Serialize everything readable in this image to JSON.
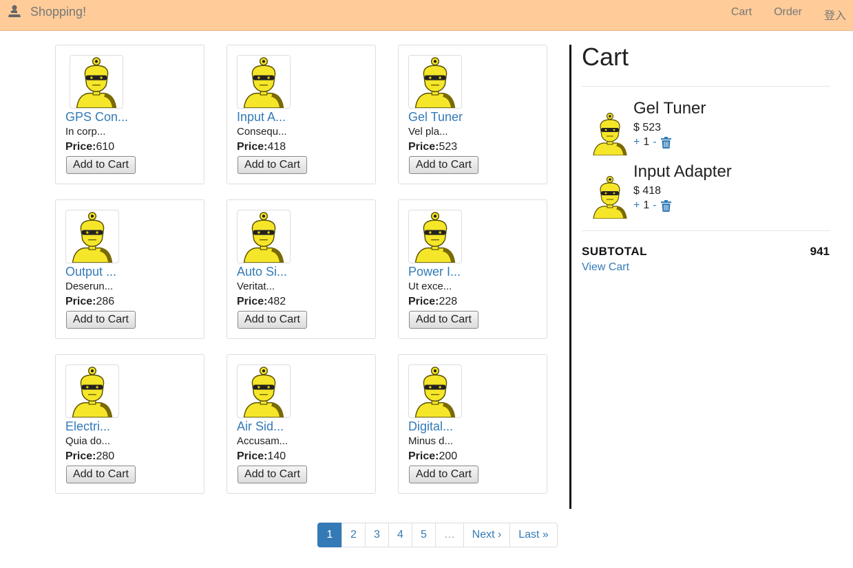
{
  "navbar": {
    "brand": "Shopping!",
    "brand_icon": "shopping-logo-icon",
    "links": [
      "Cart",
      "Order",
      "登入"
    ]
  },
  "products": [
    {
      "name": "GPS Con...",
      "desc": "In corp...",
      "price_label": "Price:",
      "price": "610",
      "button": "Add to Cart"
    },
    {
      "name": "Input A...",
      "desc": "Consequ...",
      "price_label": "Price:",
      "price": "418",
      "button": "Add to Cart"
    },
    {
      "name": "Gel Tuner",
      "desc": "Vel pla...",
      "price_label": "Price:",
      "price": "523",
      "button": "Add to Cart"
    },
    {
      "name": "Output ...",
      "desc": "Deserun...",
      "price_label": "Price:",
      "price": "286",
      "button": "Add to Cart"
    },
    {
      "name": "Auto Si...",
      "desc": "Veritat...",
      "price_label": "Price:",
      "price": "482",
      "button": "Add to Cart"
    },
    {
      "name": "Power I...",
      "desc": "Ut exce...",
      "price_label": "Price:",
      "price": "228",
      "button": "Add to Cart"
    },
    {
      "name": "Electri...",
      "desc": "Quia do...",
      "price_label": "Price:",
      "price": "280",
      "button": "Add to Cart"
    },
    {
      "name": "Air Sid...",
      "desc": "Accusam...",
      "price_label": "Price:",
      "price": "140",
      "button": "Add to Cart"
    },
    {
      "name": "Digital...",
      "desc": "Minus d...",
      "price_label": "Price:",
      "price": "200",
      "button": "Add to Cart"
    }
  ],
  "cart": {
    "title": "Cart",
    "items": [
      {
        "name": "Gel Tuner",
        "price": "$ 523",
        "plus": "+",
        "qty": "1",
        "minus": "-"
      },
      {
        "name": "Input Adapter",
        "price": "$ 418",
        "plus": "+",
        "qty": "1",
        "minus": "-"
      }
    ],
    "subtotal_label": "SUBTOTAL",
    "subtotal_value": "941",
    "view_cart": "View Cart"
  },
  "pagination": {
    "pages": [
      "1",
      "2",
      "3",
      "4",
      "5",
      "…",
      "Next ›",
      "Last »"
    ],
    "active": "1"
  },
  "colors": {
    "navbar_bg": "#ffcc99",
    "link": "#337ab7",
    "active_page": "#337ab7",
    "robot_yellow": "#f5e62a"
  }
}
